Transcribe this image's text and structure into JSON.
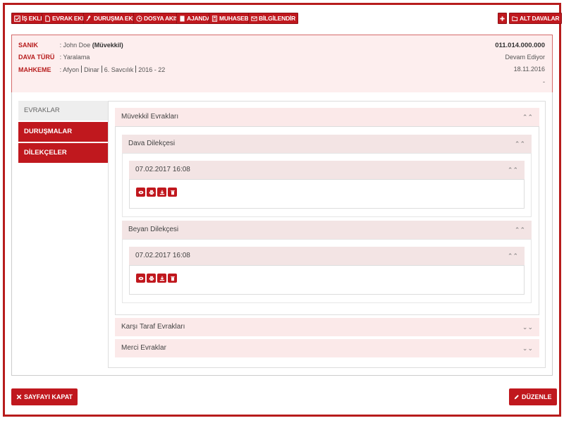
{
  "toolbar": {
    "buttons": [
      {
        "label": "İŞ EKLE",
        "icon": "check-square-icon"
      },
      {
        "label": "EVRAK EKLE",
        "icon": "file-icon"
      },
      {
        "label": "DURUŞMA EKLE",
        "icon": "gavel-icon"
      },
      {
        "label": "DOSYA AKIŞI",
        "icon": "clock-icon"
      },
      {
        "label": "AJANDA",
        "icon": "book-icon"
      },
      {
        "label": "MUHASEBE",
        "icon": "calculator-icon"
      },
      {
        "label": "BİLGİLENDİR",
        "icon": "envelope-icon"
      }
    ],
    "plus_icon": "plus-icon",
    "alt_davalar": "ALT DAVALAR"
  },
  "info": {
    "sanik_label": "SANIK",
    "sanik_name": "John Doe",
    "sanik_role": "(Müvekkil)",
    "dava_turu_label": "DAVA TÜRÜ",
    "dava_turu": "Yaralama",
    "mahkeme_label": "MAHKEME",
    "mahkeme_parts": [
      "Afyon",
      "Dinar",
      "6. Savcılık",
      "2016 - 22"
    ],
    "file_number": "011.014.000.000",
    "status": "Devam Ediyor",
    "date": "18.11.2016",
    "extra": "-"
  },
  "sidebar": {
    "items": [
      {
        "label": "EVRAKLAR"
      },
      {
        "label": "DURUŞMALAR"
      },
      {
        "label": "DİLEKÇELER"
      }
    ]
  },
  "documents": {
    "muvekkil": "Müvekkil Evrakları",
    "dava_dilekcesi": "Dava Dilekçesi",
    "dava_date": "07.02.2017 16:08",
    "beyan_dilekcesi": "Beyan Dilekçesi",
    "beyan_date": "07.02.2017 16:08",
    "karsi_taraf": "Karşı Taraf Evrakları",
    "merci": "Merci Evraklar"
  },
  "footer": {
    "close_label": "SAYFAYI KAPAT",
    "edit_label": "DÜZENLE"
  },
  "colors": {
    "accent": "#c0181e",
    "panel": "#fbe9e9",
    "frame": "#b71c1c"
  }
}
